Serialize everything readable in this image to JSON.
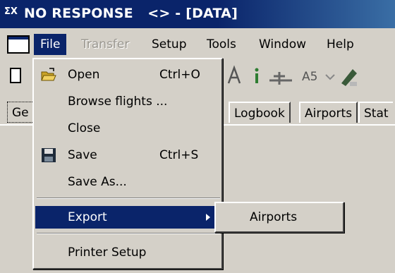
{
  "window": {
    "title": "NO RESPONSE   <> - [DATA]"
  },
  "menubar": [
    {
      "label": "File",
      "state": "active"
    },
    {
      "label": "Transfer",
      "state": "disabled"
    },
    {
      "label": "Setup",
      "state": "normal"
    },
    {
      "label": "Tools",
      "state": "normal"
    },
    {
      "label": "Window",
      "state": "normal"
    },
    {
      "label": "Help",
      "state": "normal"
    }
  ],
  "toolbar": {
    "size_label": "A5"
  },
  "tabs": [
    {
      "label": "Ge"
    },
    {
      "label": "Logbook"
    },
    {
      "label": "Airports"
    },
    {
      "label": "Stat"
    }
  ],
  "file_menu": {
    "items": [
      {
        "label": "Open",
        "shortcut": "Ctrl+O",
        "icon": "open-folder-icon"
      },
      {
        "label": "Browse flights ...",
        "shortcut": ""
      },
      {
        "label": "Close",
        "shortcut": ""
      },
      {
        "label": "Save",
        "shortcut": "Ctrl+S",
        "icon": "floppy-disk-icon"
      },
      {
        "label": "Save As...",
        "shortcut": ""
      },
      {
        "label": "Export",
        "shortcut": "",
        "highlighted": true,
        "has_submenu": true
      },
      {
        "label": "Printer Setup",
        "shortcut": ""
      }
    ]
  },
  "export_submenu": {
    "items": [
      {
        "label": "Airports"
      }
    ]
  },
  "colors": {
    "titlebar": "#0a246a",
    "highlight": "#0a246a",
    "face": "#d4d0c8"
  }
}
